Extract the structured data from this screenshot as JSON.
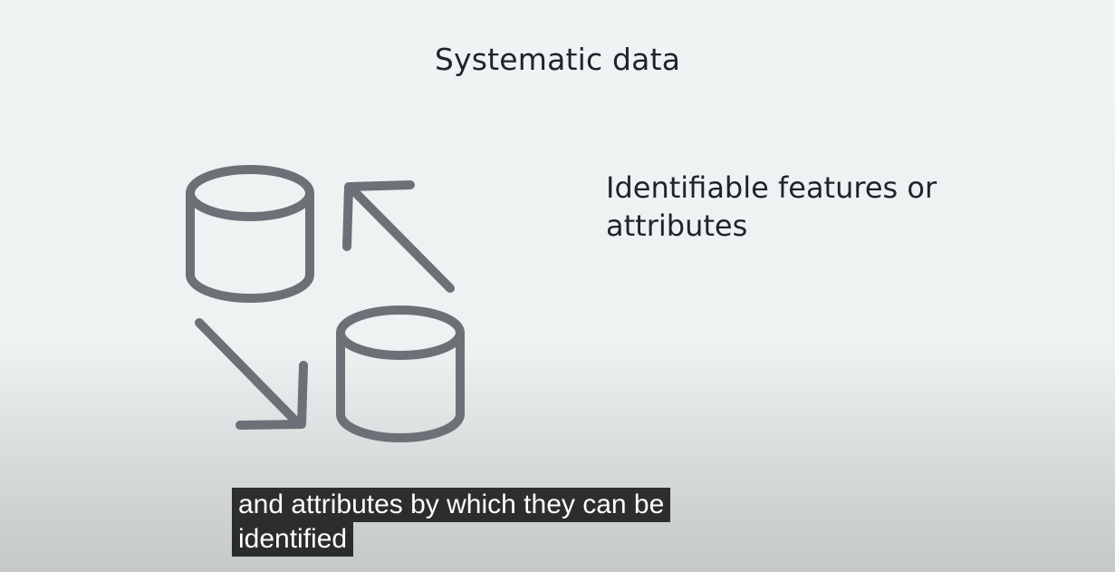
{
  "slide": {
    "title": "Systematic data",
    "subheading_lines": [
      "Identifiable features or",
      "attributes"
    ]
  },
  "icons": {
    "top_database": "database-icon",
    "bottom_database": "database-icon",
    "up_arrow": "arrow-up-left-icon",
    "down_arrow": "arrow-down-right-icon",
    "stroke_color": "#6b7177"
  },
  "caption": {
    "lines": [
      "and attributes by which they can be",
      "identified"
    ]
  }
}
